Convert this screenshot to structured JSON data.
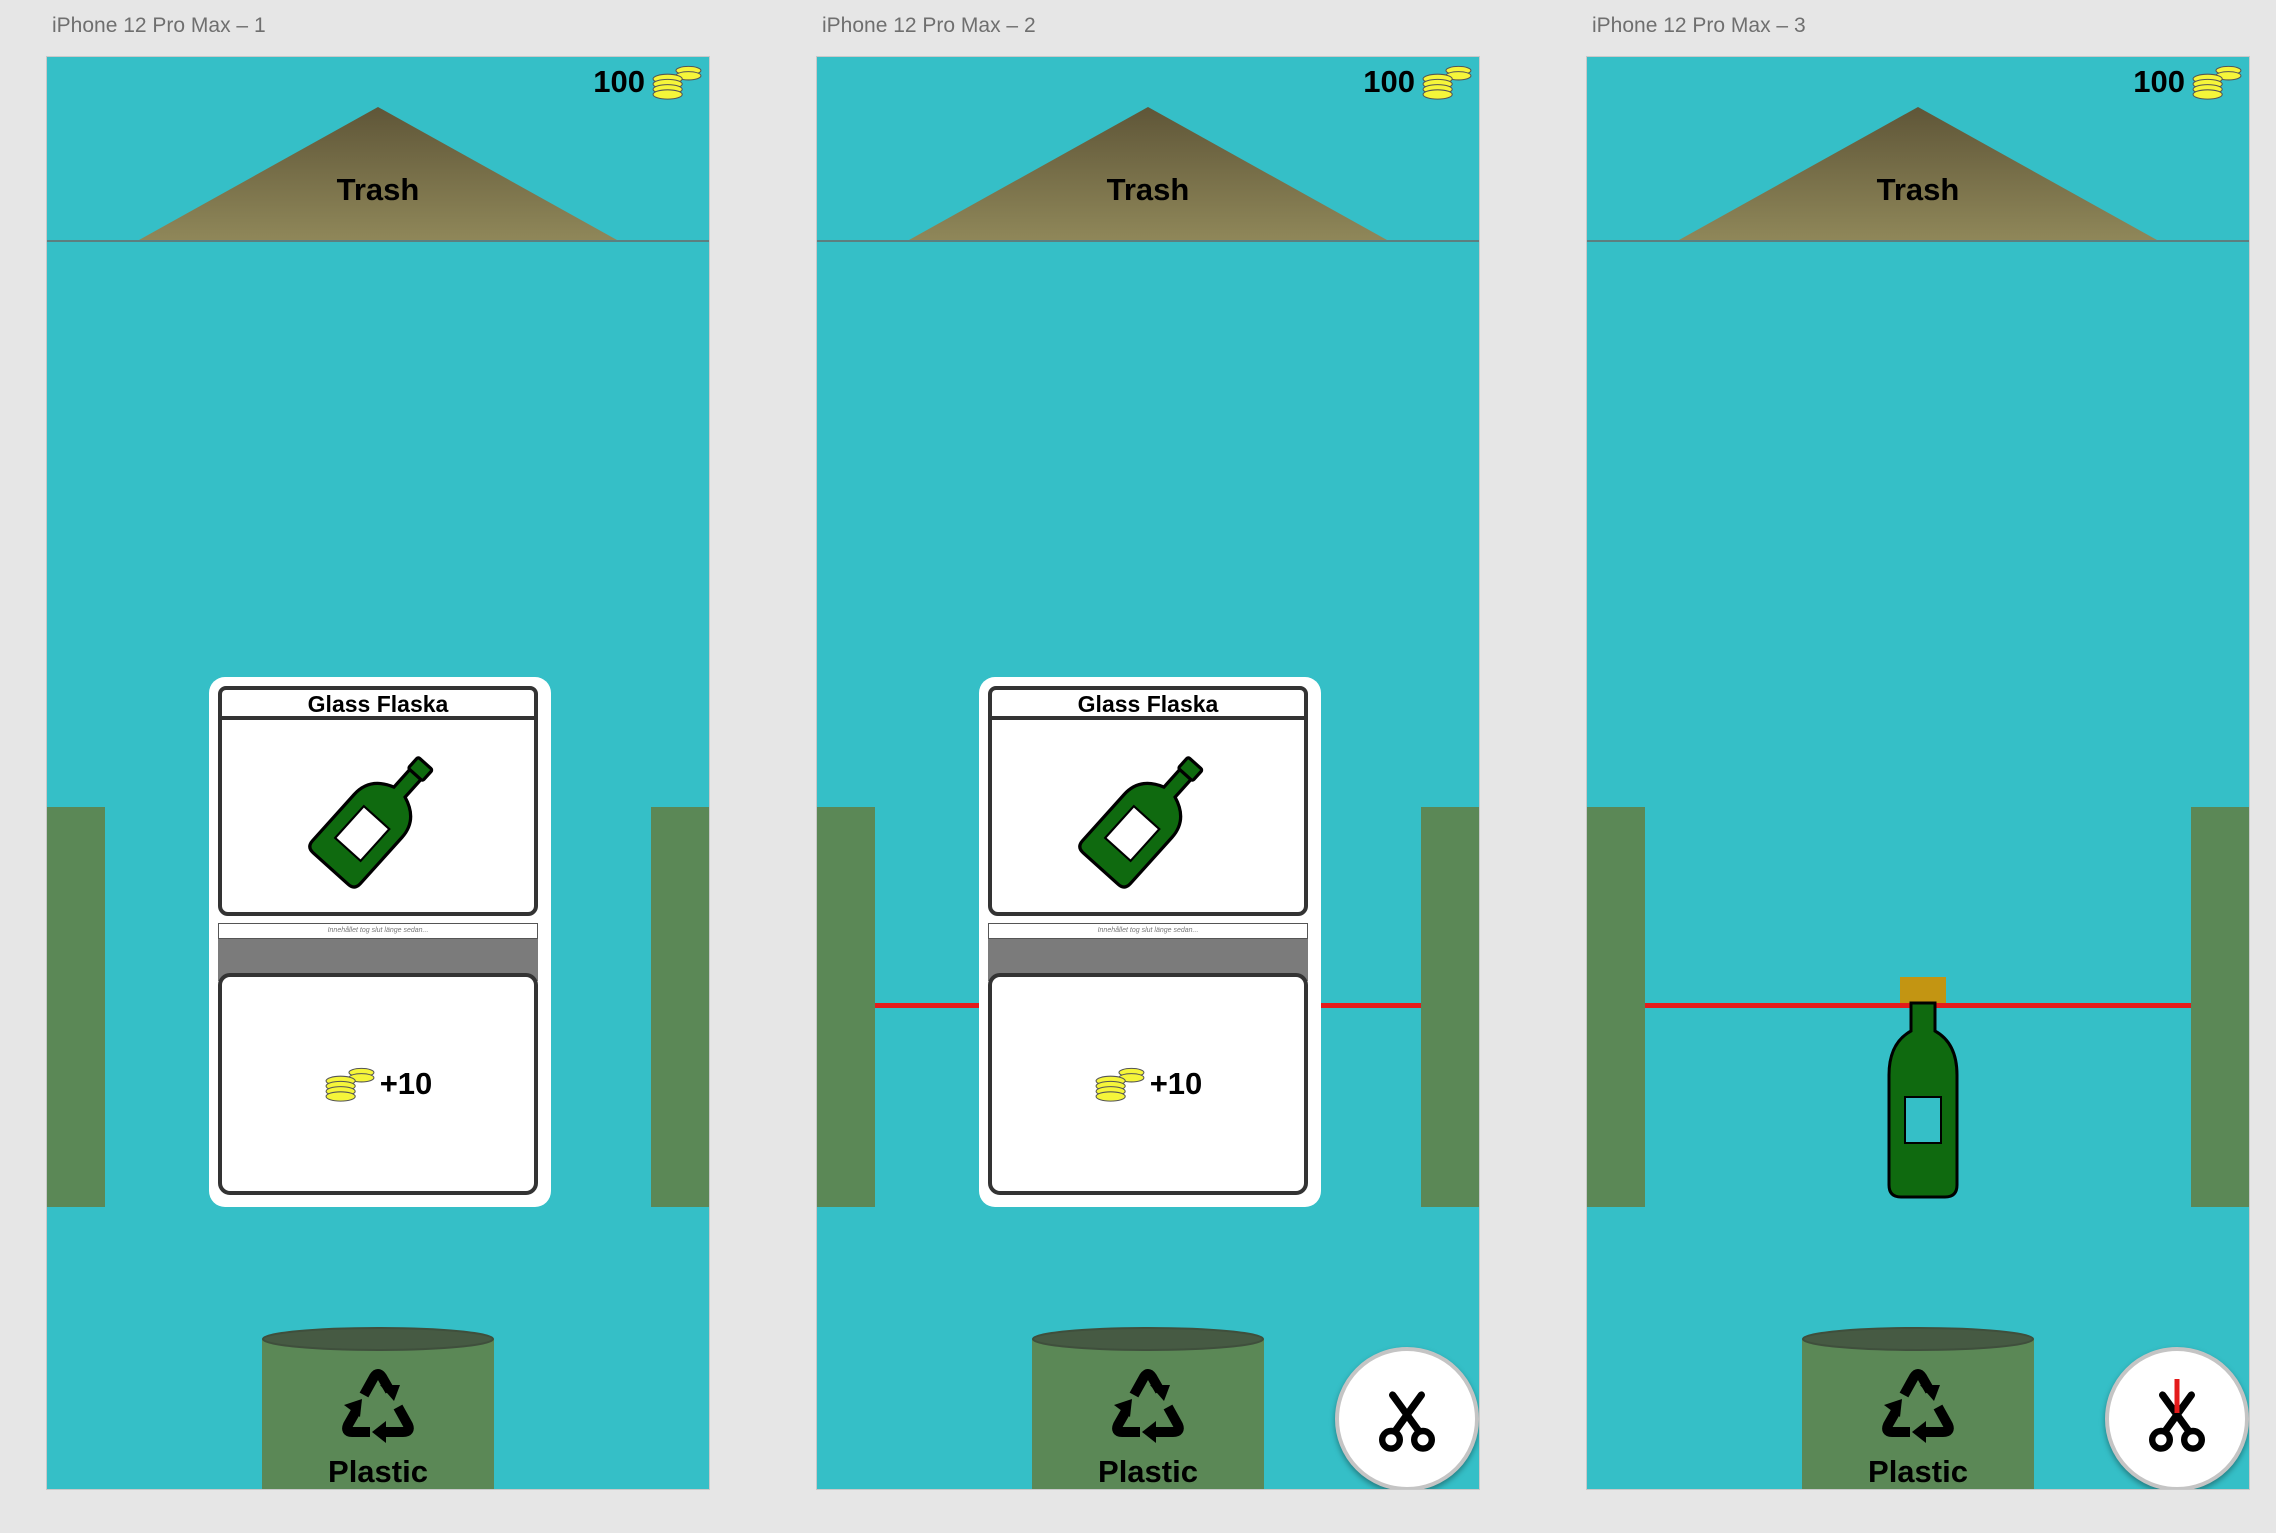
{
  "frames": [
    {
      "label": "iPhone 12 Pro Max – 1",
      "coins": "100",
      "trash_label": "Trash",
      "card_title": "Glass Flaska",
      "card_caption": "Innehållet tog slut länge sedan...",
      "reward": "+10",
      "bin_label": "Plastic"
    },
    {
      "label": "iPhone 12 Pro Max – 2",
      "coins": "100",
      "trash_label": "Trash",
      "card_title": "Glass Flaska",
      "card_caption": "Innehållet tog slut länge sedan...",
      "reward": "+10",
      "bin_label": "Plastic"
    },
    {
      "label": "iPhone 12 Pro Max – 3",
      "coins": "100",
      "trash_label": "Trash",
      "bin_label": "Plastic"
    }
  ],
  "colors": {
    "water": "#35bfc7",
    "mountain_top": "#5f5638",
    "mountain_base": "#8f8759",
    "post": "#5b8856",
    "bin": "#5b8856",
    "laser": "#e41b1b",
    "bottle": "#0f6a0f",
    "bottle_cap": "#c39512",
    "coin": "#f5f53a"
  },
  "icons": {
    "coins": "coin-stack-icon",
    "bottle": "glass-bottle-icon",
    "recycle": "recycle-icon",
    "scissors": "scissors-icon"
  }
}
